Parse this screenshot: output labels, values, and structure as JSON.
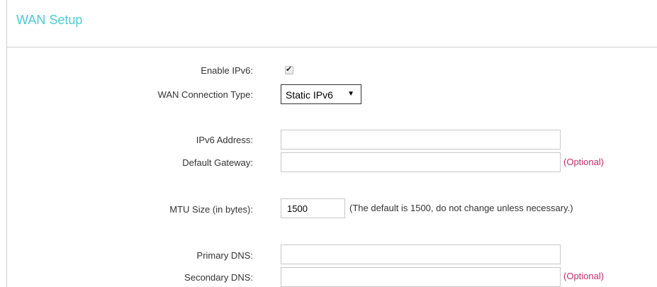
{
  "header": {
    "title": "WAN Setup"
  },
  "form": {
    "enable_ipv6": {
      "label": "Enable IPv6:",
      "checked": true
    },
    "connection_type": {
      "label": "WAN Connection Type:",
      "selected": "Static IPv6"
    },
    "ipv6_address": {
      "label": "IPv6 Address:",
      "value": ""
    },
    "default_gateway": {
      "label": "Default Gateway:",
      "value": "",
      "hint": "(Optional)"
    },
    "mtu": {
      "label": "MTU Size (in bytes):",
      "value": "1500",
      "note": "(The default is 1500, do not change unless necessary.)"
    },
    "primary_dns": {
      "label": "Primary DNS:",
      "value": ""
    },
    "secondary_dns": {
      "label": "Secondary DNS:",
      "value": "",
      "hint": "(Optional)"
    }
  },
  "colors": {
    "title": "#4acbd6",
    "optional": "#c0306a",
    "border": "#d0d0d0"
  }
}
